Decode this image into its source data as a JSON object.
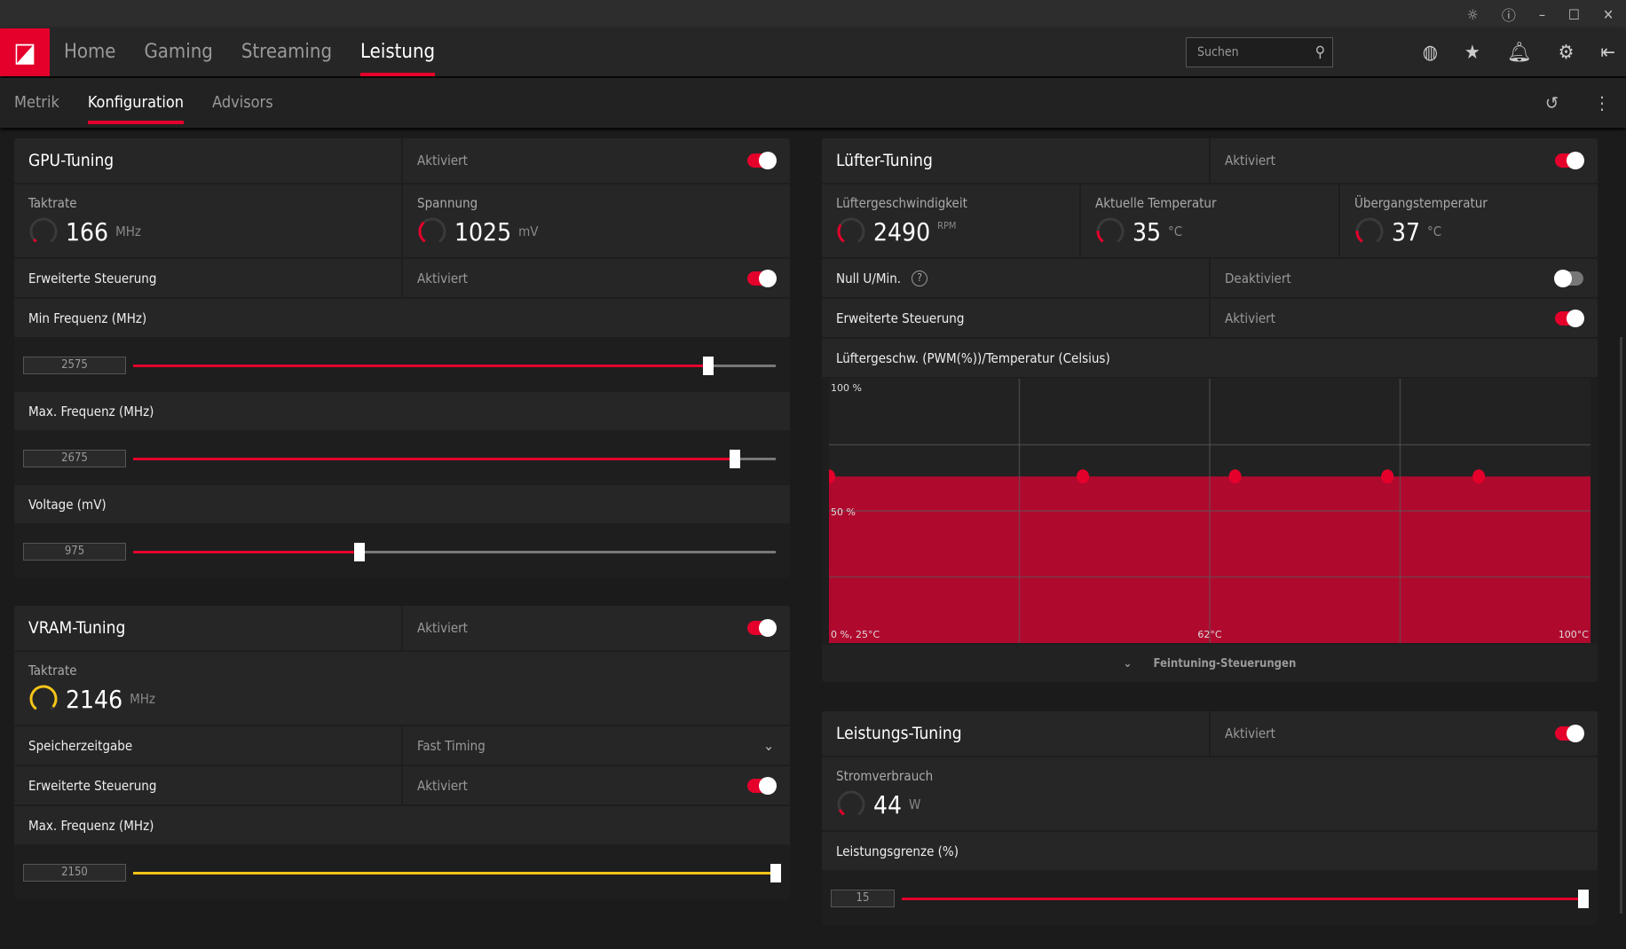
{
  "titlebar": {
    "icons": [
      "bug-icon",
      "help-icon",
      "minimize-icon",
      "maximize-icon",
      "close-icon"
    ]
  },
  "nav": {
    "tabs": [
      "Home",
      "Gaming",
      "Streaming",
      "Leistung"
    ],
    "active": 3,
    "search_placeholder": "Suchen",
    "icons": [
      "globe-icon",
      "star-icon",
      "bell-icon",
      "gear-icon",
      "sidebar-icon"
    ]
  },
  "subnav": {
    "tabs": [
      "Metrik",
      "Konfiguration",
      "Advisors"
    ],
    "active": 1
  },
  "accent": "#e4002b",
  "vram_accent": "#f5c518",
  "gpu": {
    "title": "GPU-Tuning",
    "status": "Aktiviert",
    "enabled": true,
    "clock": {
      "label": "Taktrate",
      "value": "166",
      "unit": "MHz",
      "gauge": 0.05
    },
    "voltage": {
      "label": "Spannung",
      "value": "1025",
      "unit": "mV",
      "gauge": 0.35
    },
    "advanced": {
      "label": "Erweiterte Steuerung",
      "status": "Aktiviert",
      "enabled": true
    },
    "sliders": [
      {
        "label": "Min Frequenz (MHz)",
        "value": "2575",
        "level": 0.895
      },
      {
        "label": "Max. Frequenz (MHz)",
        "value": "2675",
        "level": 0.936
      },
      {
        "label": "Voltage (mV)",
        "value": "975",
        "level": 0.352
      }
    ]
  },
  "vram": {
    "title": "VRAM-Tuning",
    "status": "Aktiviert",
    "enabled": true,
    "clock": {
      "label": "Taktrate",
      "value": "2146",
      "unit": "MHz",
      "gauge": 0.95
    },
    "timing": {
      "label": "Speicherzeitgabe",
      "value": "Fast Timing"
    },
    "advanced": {
      "label": "Erweiterte Steuerung",
      "status": "Aktiviert",
      "enabled": true
    },
    "slider": {
      "label": "Max. Frequenz (MHz)",
      "value": "2150",
      "level": 1.0
    }
  },
  "fan": {
    "title": "Lüfter-Tuning",
    "status": "Aktiviert",
    "enabled": true,
    "speed": {
      "label": "Lüftergeschwindigkeit",
      "value": "2490",
      "unit": "RPM",
      "gauge": 0.3
    },
    "temp": {
      "label": "Aktuelle Temperatur",
      "value": "35",
      "unit": "°C",
      "gauge": 0.2
    },
    "junction": {
      "label": "Übergangstemperatur",
      "value": "37",
      "unit": "°C",
      "gauge": 0.2
    },
    "zero_rpm": {
      "label": "Null U/Min.",
      "status": "Deaktiviert",
      "enabled": false
    },
    "advanced": {
      "label": "Erweiterte Steuerung",
      "status": "Aktiviert",
      "enabled": true
    },
    "curve_title": "Lüftergeschw. (PWM(%))/Temperatur (Celsius)",
    "fine_tuning": "Feintuning-Steuerungen"
  },
  "chart_data": {
    "type": "area",
    "xlim": [
      25,
      100
    ],
    "ylim": [
      0,
      100
    ],
    "grid": true,
    "tick_labels": {
      "y_top": "100 %",
      "y_mid": "50 %",
      "origin": "0 %, 25°C",
      "x_mid": "62°C",
      "x_max": "100°C"
    },
    "x": [
      25,
      50,
      65,
      80,
      89
    ],
    "y": [
      63,
      63,
      63,
      63,
      63
    ]
  },
  "power": {
    "title": "Leistungs-Tuning",
    "status": "Aktiviert",
    "enabled": true,
    "draw": {
      "label": "Stromverbrauch",
      "value": "44",
      "unit": "W",
      "gauge": 0.1
    },
    "slider": {
      "label": "Leistungsgrenze (%)",
      "value": "15",
      "level": 1.0
    }
  }
}
